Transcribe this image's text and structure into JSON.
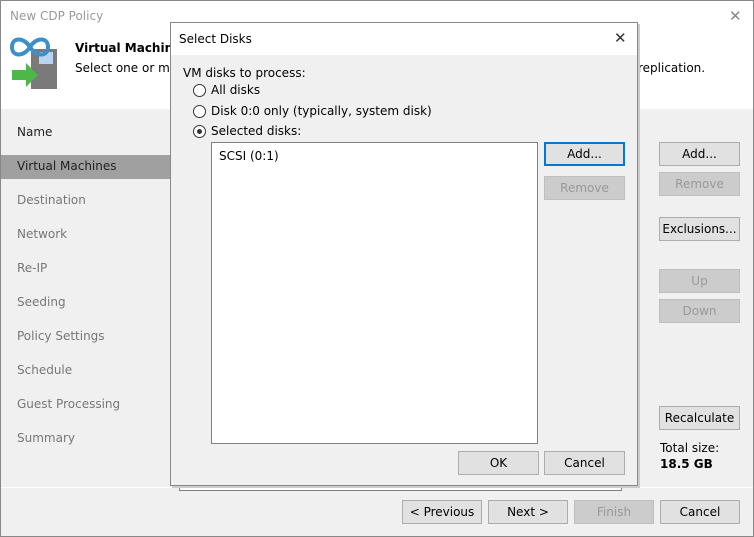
{
  "window": {
    "title": "New CDP Policy",
    "close": "✕"
  },
  "header": {
    "title": "Virtual Machines",
    "subtitle": "Select one or more",
    "subtitle_tail": "replication."
  },
  "sidebar": {
    "items": [
      "Name",
      "Virtual Machines",
      "Destination",
      "Network",
      "Re-IP",
      "Seeding",
      "Policy Settings",
      "Schedule",
      "Guest Processing",
      "Summary"
    ],
    "selected": 1
  },
  "right_buttons": {
    "add": "Add...",
    "remove": "Remove",
    "exclusions": "Exclusions...",
    "up": "Up",
    "down": "Down",
    "recalculate": "Recalculate"
  },
  "total_size": {
    "label": "Total size:",
    "value": "18.5 GB"
  },
  "footer": {
    "previous": "< Previous",
    "next": "Next >",
    "finish": "Finish",
    "cancel": "Cancel"
  },
  "dialog": {
    "title": "Select Disks",
    "close": "✕",
    "group_label": "VM disks to process:",
    "options": [
      "All disks",
      "Disk 0:0 only (typically, system disk)",
      "Selected disks:"
    ],
    "selected_option": 2,
    "disks": [
      "SCSI (0:1)"
    ],
    "add": "Add...",
    "remove": "Remove",
    "ok": "OK",
    "cancel": "Cancel"
  },
  "colors": {
    "accent": "#0078d7",
    "selected_nav": "#a0a0a0",
    "icon_blue": "#3c8fc8",
    "icon_green": "#4db848"
  }
}
